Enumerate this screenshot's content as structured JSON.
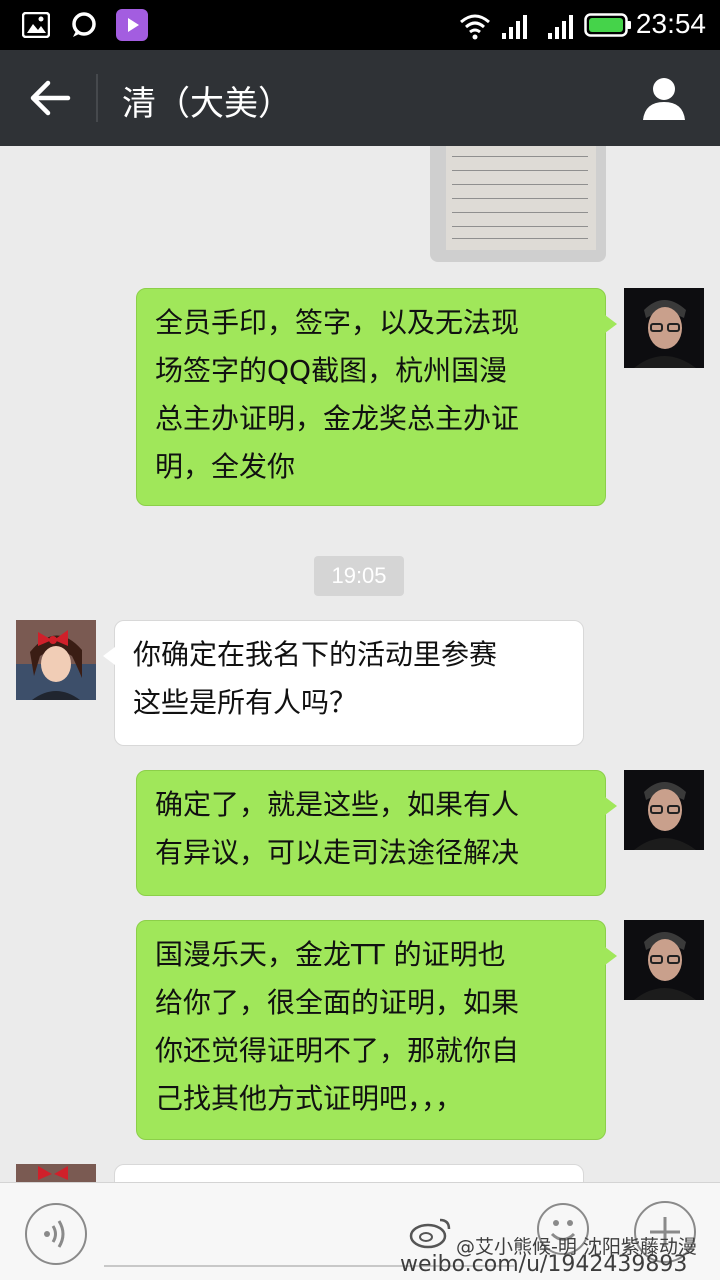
{
  "status_bar": {
    "time": "23:54",
    "icons": [
      "image-icon",
      "chat-bubble-icon",
      "video-play-icon",
      "wifi-icon",
      "signal-icon",
      "signal-icon",
      "battery-icon"
    ]
  },
  "header": {
    "title": "清（大美）",
    "back_icon": "back-arrow-icon",
    "profile_icon": "user-profile-icon"
  },
  "messages": [
    {
      "from": "me",
      "type": "image"
    },
    {
      "from": "me",
      "lines": [
        "全员手印，签字，以及无法现",
        "场签字的QQ截图，杭州国漫",
        "总主办证明，金龙奖总主办证",
        "明，全发你"
      ]
    },
    {
      "type": "timestamp",
      "text": "19:05"
    },
    {
      "from": "her",
      "lines": [
        "你确定在我名下的活动里参赛",
        "这些是所有人吗？"
      ]
    },
    {
      "from": "me",
      "lines": [
        "确定了，就是这些，如果有人",
        "有异议，可以走司法途径解决"
      ]
    },
    {
      "from": "me",
      "lines": [
        "国漫乐天，金龙TT 的证明也",
        "给你了，很全面的证明，如果",
        "你还觉得证明不了，那就你自",
        "己找其他方式证明吧，，，"
      ]
    }
  ],
  "input_bar": {
    "voice_icon": "voice-icon",
    "emoji_icon": "emoji-icon",
    "plus_icon": "plus-icon"
  },
  "watermark": {
    "line1": "@艾小熊候-明 沈阳紫藤动漫",
    "line2": "weibo.com/u/1942439893"
  },
  "colors": {
    "my_bubble": "#a0e75a",
    "their_bubble": "#ffffff",
    "header_bg": "#2f3236",
    "chat_bg": "#ebebeb"
  }
}
